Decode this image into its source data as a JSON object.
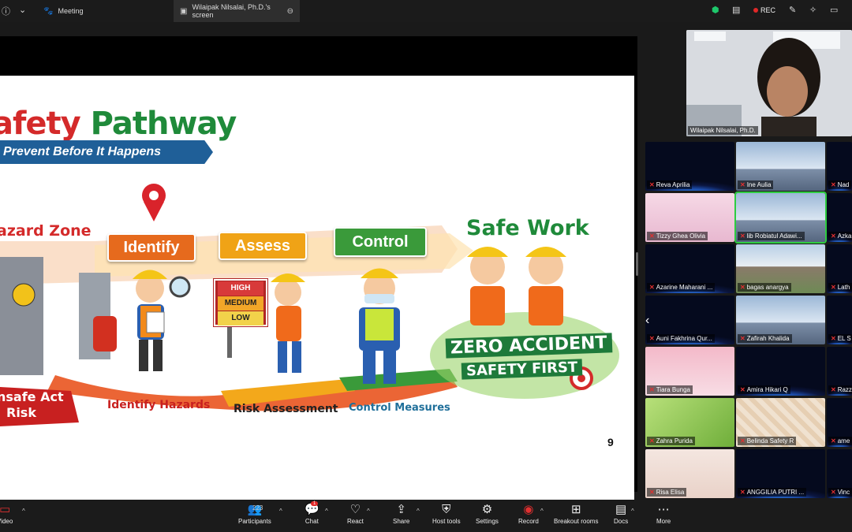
{
  "topbar": {
    "meeting_tab": "Meeting",
    "share_tab": "Wilaipak Nilsalai, Ph.D.'s screen",
    "rec_label": "REC"
  },
  "slide": {
    "title_red": "afety",
    "title_green": "Pathway",
    "subtitle": "Prevent Before It Happens",
    "hazard_zone": "azard Zone",
    "unsafe": "nsafe Act",
    "risk": "Risk",
    "sign_identify": "Identify",
    "sign_assess": "Assess",
    "sign_control": "Control",
    "safe_work": "Safe Work",
    "high": "HIGH",
    "medium": "MEDIUM",
    "low": "LOW",
    "zero_accident": "ZERO ACCIDENT",
    "safety_first": "SAFETY FIRST",
    "identify_hazards": "Identify Hazards",
    "risk_assessment": "Risk Assessment",
    "control_measures": "Control Measures",
    "page_number": "9"
  },
  "self_view": {
    "name": "Wilaipak Nilsalai, Ph.D."
  },
  "participants": [
    "Reva Aprilia",
    "Ine Aulia",
    "Nad",
    "Tizzy Ghea Olivia",
    "lib Robiatul Adawi...",
    "Azka",
    "Azarine Maharani ...",
    "bagas anargya",
    "Lath",
    "Auni Fakhrina Qur...",
    "Zafirah Khalida",
    "EL S",
    "Tiara Bunga",
    "Amira Hikari Q",
    "Razz",
    "Zahra Purida",
    "Belinda Safety R",
    "ame",
    "Risa Elisa",
    "ANGGILIA PUTRI ...",
    "Vinc"
  ],
  "toolbar": {
    "video": "Video",
    "participants": "Participants",
    "participants_count": "223",
    "chat": "Chat",
    "chat_badge": "1",
    "react": "React",
    "share": "Share",
    "host_tools": "Host tools",
    "settings": "Settings",
    "record": "Record",
    "breakout": "Breakout rooms",
    "docs": "Docs",
    "more": "More"
  }
}
